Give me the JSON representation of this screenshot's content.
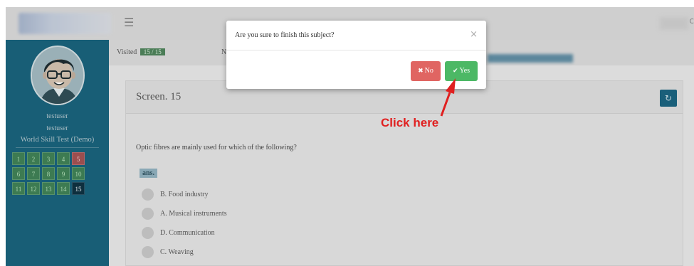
{
  "header": {
    "menu_icon": "hamburger-icon",
    "menu_glyph": "☰",
    "right_glyph": "c"
  },
  "sidebar": {
    "user_line1": "testuser",
    "user_line2": "testuser",
    "test_name": "World Skill Test (Demo)",
    "questions": [
      {
        "num": "1",
        "state": "visited"
      },
      {
        "num": "2",
        "state": "visited"
      },
      {
        "num": "3",
        "state": "visited"
      },
      {
        "num": "4",
        "state": "visited"
      },
      {
        "num": "5",
        "state": "flagged"
      },
      {
        "num": "6",
        "state": "visited"
      },
      {
        "num": "7",
        "state": "visited"
      },
      {
        "num": "8",
        "state": "visited"
      },
      {
        "num": "9",
        "state": "visited"
      },
      {
        "num": "10",
        "state": "visited"
      },
      {
        "num": "11",
        "state": "visited"
      },
      {
        "num": "12",
        "state": "visited"
      },
      {
        "num": "13",
        "state": "visited"
      },
      {
        "num": "14",
        "state": "visited"
      },
      {
        "num": "15",
        "state": "current"
      }
    ]
  },
  "status": {
    "visited_label": "Visited",
    "visited_count": "15 / 15",
    "second_label": "N"
  },
  "screen": {
    "title": "Screen. 15",
    "question": "Optic fibres are mainly used for which of the following?",
    "answer_label": "ans.",
    "options": [
      "B. Food industry",
      "A. Musical instruments",
      "D. Communication",
      "C. Weaving"
    ]
  },
  "modal": {
    "title": "Are you sure to finish this subject?",
    "close_glyph": "×",
    "no_label": "No",
    "yes_label": "Yes"
  },
  "annotation": {
    "text": "Click here"
  },
  "colors": {
    "sidebar": "#185e76",
    "yes": "#4cb865",
    "no": "#e06562",
    "annotation": "#e02020"
  }
}
